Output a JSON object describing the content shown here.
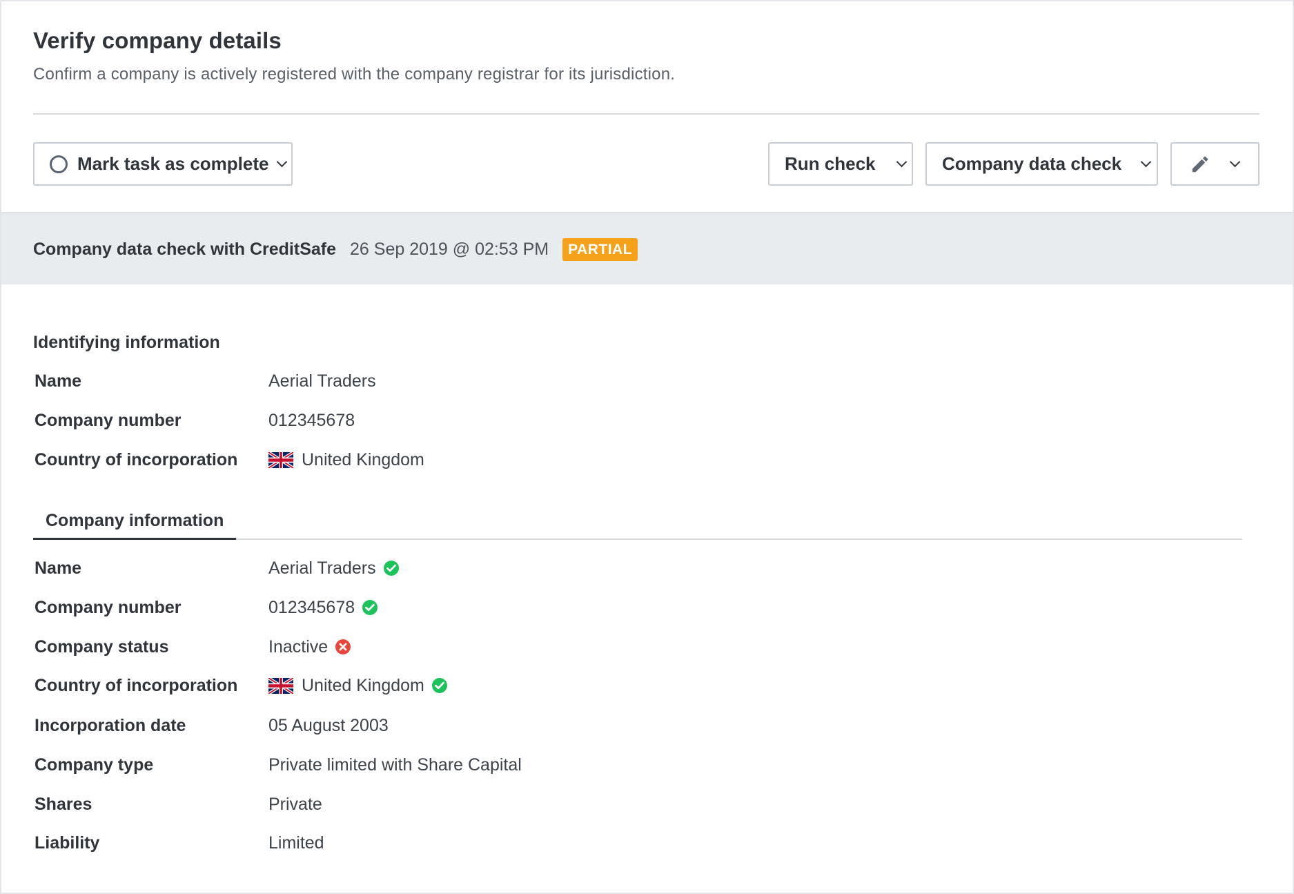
{
  "page": {
    "title": "Verify company details",
    "subtitle": "Confirm a company is actively registered with the company registrar for its jurisdiction."
  },
  "toolbar": {
    "mark_complete_label": "Mark task as complete",
    "run_check_label": "Run check",
    "check_type_label": "Company data check",
    "edit_icon": "pencil-icon"
  },
  "check": {
    "title": "Company data check with CreditSafe",
    "timestamp": "26 Sep 2019 @ 02:53 PM",
    "status": "PARTIAL",
    "status_color": "#f5a11a"
  },
  "identifying": {
    "heading": "Identifying information",
    "rows": [
      {
        "label": "Name",
        "value": "Aerial Traders"
      },
      {
        "label": "Company number",
        "value": "012345678"
      },
      {
        "label": "Country of incorporation",
        "value": "United Kingdom",
        "flag": "uk-flag"
      }
    ]
  },
  "company": {
    "tab_label": "Company information",
    "rows": [
      {
        "label": "Name",
        "value": "Aerial Traders",
        "status": "match"
      },
      {
        "label": "Company number",
        "value": "012345678",
        "status": "match"
      },
      {
        "label": "Company status",
        "value": "Inactive",
        "status": "mismatch"
      },
      {
        "label": "Country of incorporation",
        "value": "United Kingdom",
        "flag": "uk-flag",
        "status": "match"
      },
      {
        "label": "Incorporation date",
        "value": "05 August 2003"
      },
      {
        "label": "Company type",
        "value": "Private limited with Share Capital"
      },
      {
        "label": "Shares",
        "value": "Private"
      },
      {
        "label": "Liability",
        "value": "Limited"
      }
    ]
  },
  "colors": {
    "match": "#1ec25a",
    "mismatch": "#e8453c"
  }
}
